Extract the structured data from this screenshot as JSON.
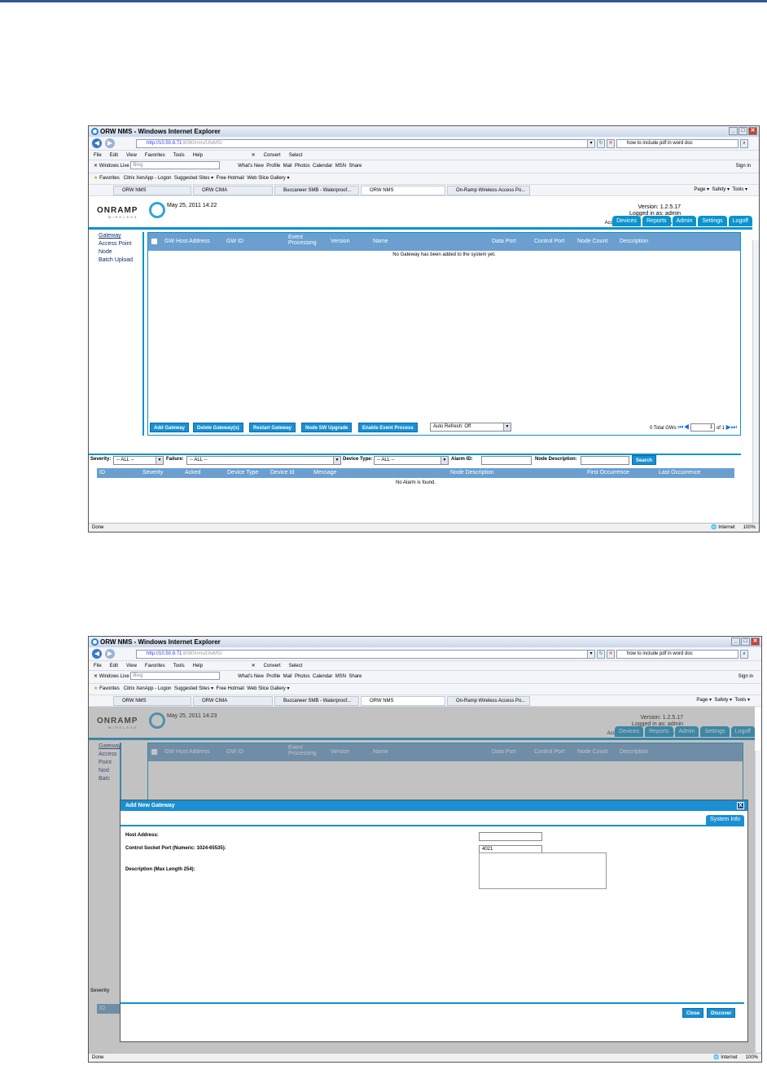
{
  "browser": {
    "title": "ORW NMS - Windows Internet Explorer",
    "url_host": "http://10.50.8.71",
    "url_path": ":8080/nms/UloMS/",
    "search_text": "how to include pdf in word doc",
    "menu": [
      "File",
      "Edit",
      "View",
      "Favorites",
      "Tools",
      "Help"
    ],
    "commands": [
      "Convert",
      "Select"
    ],
    "wl_label": "Windows Live",
    "wl_placeholder": "Bing",
    "wl_links": [
      "What's New",
      "Profile",
      "Mail",
      "Photos",
      "Calendar",
      "MSN",
      "Share"
    ],
    "sign_in": "Sign in",
    "fav_label": "Favorites",
    "fav_links": [
      "Citrix XenApp - Logon",
      "Suggested Sites ▾",
      "Free Hotmail",
      "Web Slice Gallery ▾"
    ],
    "tabs": [
      "ORW NMS",
      "ORW CIMA",
      "Buccaneer SMB - Waterproof...",
      "ORW NMS",
      "On-Ramp Wireless Access Po..."
    ],
    "tools": [
      "Page ▾",
      "Safety ▾",
      "Tools ▾"
    ],
    "status_left": "Done",
    "status_zone": "Internet",
    "status_zoom": "100%"
  },
  "app": {
    "logo": "ONRAMP",
    "logo_sub": "WIRELESS",
    "version": "Version: 1.2.5.17",
    "logged": "Logged in as: admin",
    "ap_info": "Access Points: 0 Joined Nodes: 0",
    "nav_tabs": [
      "Devices",
      "Reports",
      "Admin",
      "Settings",
      "Logoff"
    ],
    "side": [
      "Gateway",
      "Access Point",
      "Node",
      "Batch Upload"
    ],
    "columns": [
      "GW Host Address",
      "GW ID",
      "Event Processing",
      "Version",
      "Name",
      "Data Port",
      "Control Port",
      "Node Count",
      "Description"
    ],
    "empty_msg": "No Gateway has been added to the system yet.",
    "buttons": [
      "Add Gateway",
      "Delete Gateway(s)",
      "Restart Gateway",
      "Node SW Upgrade",
      "Enable Event Process"
    ],
    "auto_refresh": "Auto Refresh: Off",
    "total": "0 Total GWs",
    "page": "1",
    "of": "of 1",
    "filters": {
      "severity": "Severity:",
      "severity_val": "-- ALL --",
      "failure": "Failure:",
      "failure_val": "-- ALL --",
      "device_type": "Device Type:",
      "device_type_val": "-- ALL --",
      "alarm_id": "Alarm ID:",
      "node_desc": "Node Description:",
      "search": "Search"
    },
    "alarm_cols": [
      "ID",
      "Severity",
      "Acked",
      "Device Type",
      "Device Id",
      "Message",
      "Node Description",
      "First Occurrence",
      "Last Occurrence"
    ],
    "alarm_empty": "No Alarm is found."
  },
  "shot1": {
    "date": "May 25, 2011 14:22"
  },
  "shot2": {
    "date": "May 25, 2011 14:23",
    "side_partial": [
      "Gateway",
      "Access Point",
      "Nod",
      "Batc"
    ],
    "severity_partial": "Severity",
    "modal": {
      "title": "Add New Gateway",
      "close_x": "X",
      "tab": "System Info",
      "host_label": "Host Address:",
      "port_label": "Control Socket Port (Numeric: 1024-65535):",
      "port_value": "4021",
      "desc_label": "Description (Max Length 254):",
      "close": "Close",
      "discover": "Discover"
    }
  }
}
